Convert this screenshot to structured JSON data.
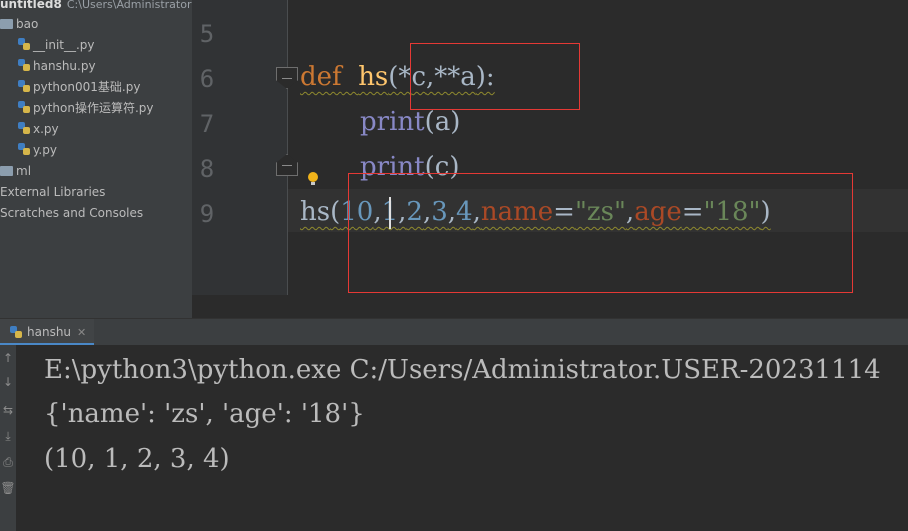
{
  "project": {
    "title": "untitled8",
    "path": "C:\\Users\\Administrator",
    "tree": [
      {
        "label": "bao",
        "kind": "folder"
      },
      {
        "label": "__init__.py",
        "kind": "file"
      },
      {
        "label": "hanshu.py",
        "kind": "file"
      },
      {
        "label": "python001基础.py",
        "kind": "file"
      },
      {
        "label": "python操作运算符.py",
        "kind": "file"
      },
      {
        "label": "x.py",
        "kind": "file"
      },
      {
        "label": "y.py",
        "kind": "file"
      },
      {
        "label": "ml",
        "kind": "folder"
      },
      {
        "label": "External Libraries",
        "kind": "item"
      },
      {
        "label": "Scratches and Consoles",
        "kind": "item"
      }
    ]
  },
  "editor": {
    "line_numbers": [
      "5",
      "6",
      "7",
      "8",
      "9"
    ],
    "line6": {
      "def": "def",
      "name": "hs",
      "open": "(*",
      "p1": "c",
      "sep": ",**",
      "p2": "a",
      "close": "):"
    },
    "line7": {
      "fn": "print",
      "open": "(",
      "arg": "a",
      "close": ")"
    },
    "line8": {
      "fn": "print",
      "open": "(",
      "arg": "c",
      "close": ")"
    },
    "line9": {
      "name": "hs",
      "open": "(",
      "n1": "10",
      "c1": ",",
      "n2": "1",
      "c2": ",",
      "n3": "2",
      "c3": ",",
      "n4": "3",
      "c4": ",",
      "n5": "4",
      "c5": ",",
      "k1": "name",
      "eq1": "=",
      "s1": "\"zs\"",
      "c6": ",",
      "k2": "age",
      "eq2": "=",
      "s2": "\"18\"",
      "close": ")"
    }
  },
  "run": {
    "tab_label": "hanshu",
    "toolbar": [
      "↑",
      "↓",
      "⇆",
      "⤓",
      "⎙",
      "🗑"
    ],
    "output": [
      "E:\\python3\\python.exe C:/Users/Administrator.USER-20231114",
      "{'name': 'zs', 'age': '18'}",
      "(10, 1, 2, 3, 4)"
    ]
  },
  "colors": {
    "keyword": "#cc7832",
    "function": "#ffc66d",
    "number": "#6897bb",
    "string": "#6a8759",
    "parameter": "#aa4926",
    "builtin": "#8888c6",
    "annotation_box": "#e53935"
  }
}
